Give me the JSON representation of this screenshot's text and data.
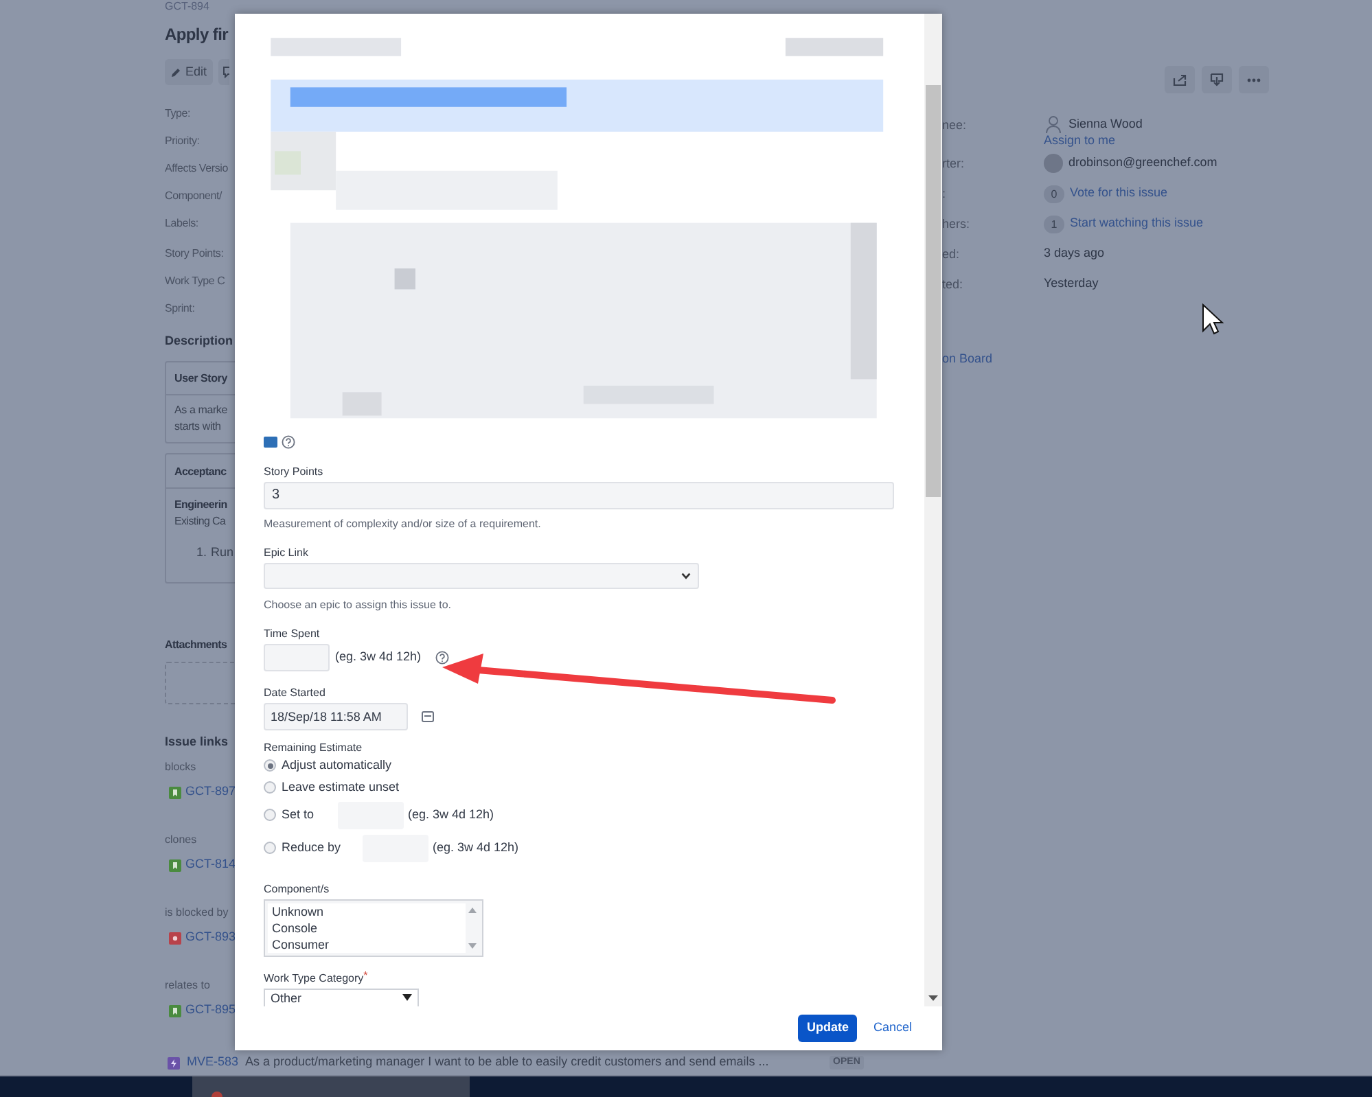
{
  "issue": {
    "key": "GCT-894",
    "title": "Apply fir",
    "edit_label": "Edit",
    "fields": [
      "Type:",
      "Priority:",
      "Affects Versio",
      "Component/",
      "Labels:",
      "Story Points:",
      "Work Type C",
      "Sprint:"
    ],
    "description": {
      "heading": "Description",
      "story_title": "User Story",
      "story_lines": [
        "As a marke",
        "starts with"
      ],
      "acceptance_title": "Acceptanc",
      "acceptance_heading": "Engineerin",
      "acceptance_text": "Existing Ca",
      "list_number": "1.",
      "list_text": "Run"
    },
    "attachments_heading": "Attachments",
    "links_heading": "Issue links",
    "link_groups": [
      {
        "relation": "blocks",
        "key": "GCT-897",
        "kind": "story"
      },
      {
        "relation": "clones",
        "key": "GCT-814",
        "kind": "story"
      },
      {
        "relation": "is blocked by",
        "key": "GCT-893",
        "kind": "bug"
      },
      {
        "relation": "relates to",
        "key": "GCT-895",
        "kind": "story"
      }
    ],
    "extra_link": {
      "key": "MVE-583",
      "kind": "epic",
      "summary": "As a product/marketing manager I want to be able to easily credit customers and send emails ...",
      "status": "OPEN"
    }
  },
  "people": [
    {
      "label": "nee:",
      "kind": "user",
      "value": "Sienna Wood",
      "action": "Assign to me"
    },
    {
      "label": "rter:",
      "kind": "avatar",
      "value": "drobinson@greenchef.com"
    },
    {
      "label": ":",
      "kind": "count",
      "count": "0",
      "value": "Vote for this issue"
    },
    {
      "label": "hers:",
      "kind": "count",
      "count": "1",
      "value": "Start watching this issue"
    },
    {
      "label": "ed:",
      "kind": "text",
      "value": "3 days ago"
    },
    {
      "label": "ted:",
      "kind": "text",
      "value": "Yesterday"
    }
  ],
  "board_link": "on Board",
  "dialog": {
    "story_points": {
      "label": "Story Points",
      "value": "3",
      "hint": "Measurement of complexity and/or size of a requirement."
    },
    "epic_link": {
      "label": "Epic Link",
      "hint": "Choose an epic to assign this issue to."
    },
    "time_spent": {
      "label": "Time Spent",
      "example": "(eg. 3w 4d 12h)"
    },
    "date_started": {
      "label": "Date Started",
      "value": "18/Sep/18 11:58 AM"
    },
    "remaining_estimate": {
      "label": "Remaining Estimate",
      "options": [
        {
          "label": "Adjust automatically",
          "kind": "plain",
          "selected": true
        },
        {
          "label": "Leave estimate unset",
          "kind": "plain",
          "selected": false
        },
        {
          "label": "Set to",
          "kind": "input",
          "selected": false,
          "example": "(eg. 3w 4d 12h)"
        },
        {
          "label": "Reduce by",
          "kind": "input",
          "selected": false,
          "example": "(eg. 3w 4d 12h)"
        }
      ]
    },
    "components": {
      "label": "Component/s",
      "options": [
        "Unknown",
        "Console",
        "Consumer"
      ]
    },
    "work_type": {
      "label": "Work Type Category",
      "required_mark": "*",
      "value": "Other"
    },
    "update": "Update",
    "cancel": "Cancel"
  }
}
